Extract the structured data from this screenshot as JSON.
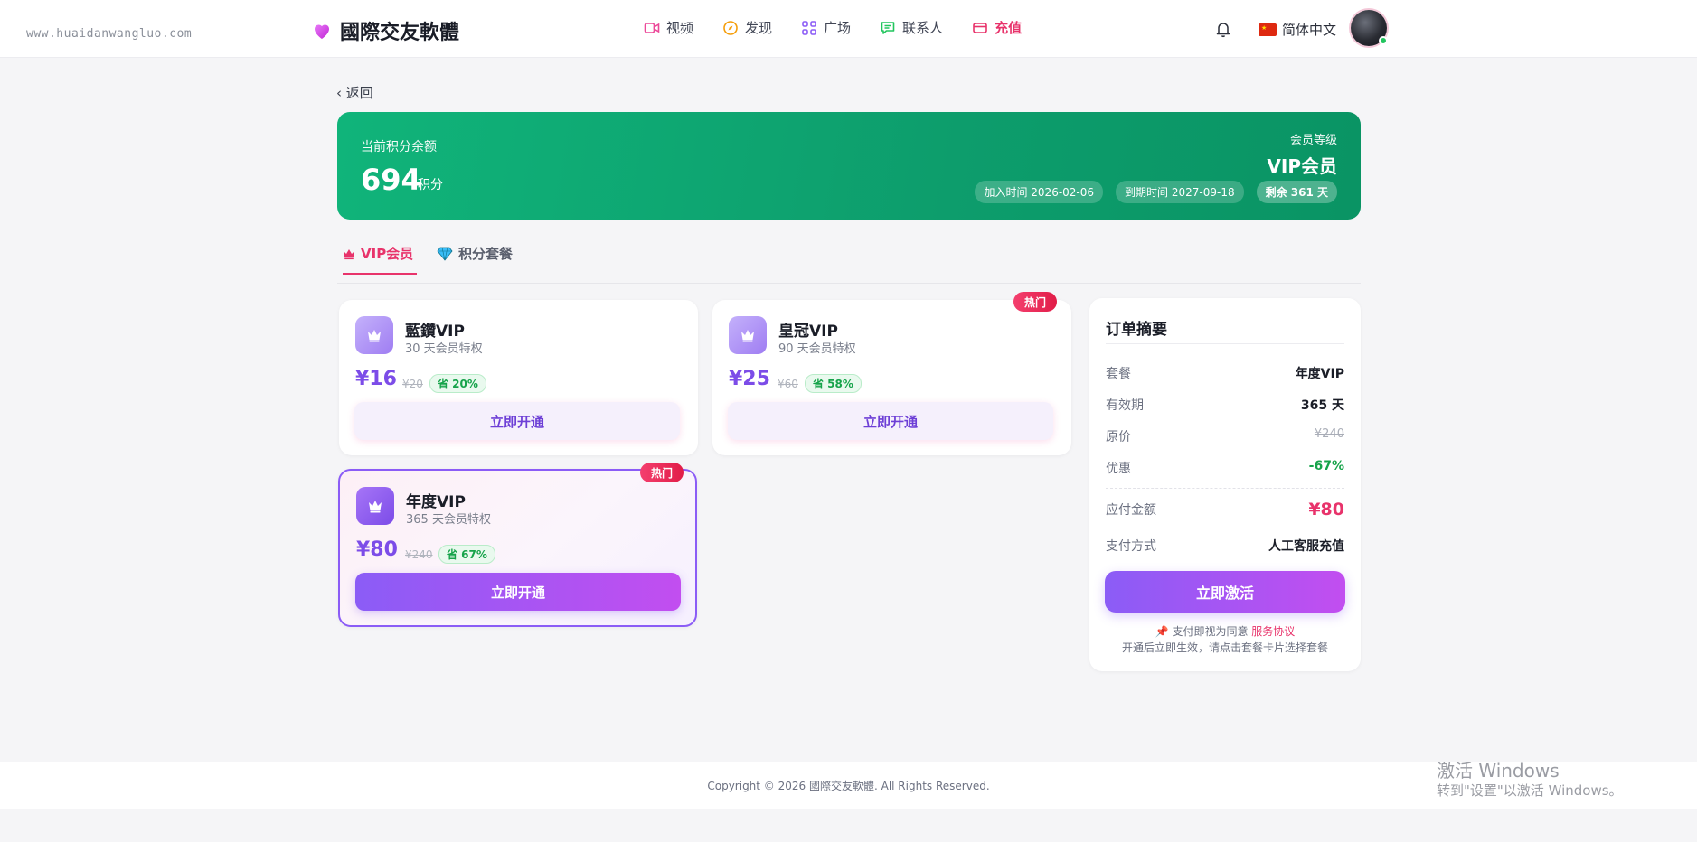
{
  "watermark": "www.huaidanwangluo.com",
  "brand": {
    "name": "國際交友軟體",
    "icon": "heart-icon"
  },
  "nav": [
    {
      "label": "视频",
      "icon": "video-icon"
    },
    {
      "label": "发现",
      "icon": "compass-icon"
    },
    {
      "label": "广场",
      "icon": "grid-icon"
    },
    {
      "label": "联系人",
      "icon": "chat-icon"
    },
    {
      "label": "充值",
      "icon": "wallet-icon",
      "active": true
    }
  ],
  "header": {
    "language": "简体中文",
    "icons": [
      "bell-icon",
      "china-flag-icon",
      "avatar"
    ]
  },
  "back_label": "返回",
  "balance": {
    "label": "当前积分余额",
    "value": "694",
    "unit": "积分",
    "level_label": "会员等级",
    "level_value": "VIP会员",
    "joined": "加入时间 2026-02-06",
    "expires": "到期时间 2027-09-18",
    "remaining": "剩余 361 天"
  },
  "tabs": [
    {
      "label": "VIP会员",
      "icon": "crown-icon",
      "active": true
    },
    {
      "label": "积分套餐",
      "icon": "diamond-icon",
      "active": false
    }
  ],
  "plans": [
    {
      "name": "藍鑽VIP",
      "desc": "30 天会员特权",
      "price": "¥16",
      "orig": "¥20",
      "save": "省 20%",
      "button": "立即开通",
      "hot": "",
      "selected": false
    },
    {
      "name": "皇冠VIP",
      "desc": "90 天会员特权",
      "price": "¥25",
      "orig": "¥60",
      "save": "省 58%",
      "button": "立即开通",
      "hot": "热门",
      "selected": false
    },
    {
      "name": "年度VIP",
      "desc": "365 天会员特权",
      "price": "¥80",
      "orig": "¥240",
      "save": "省 67%",
      "button": "立即开通",
      "hot": "热门",
      "selected": true
    }
  ],
  "summary": {
    "title": "订单摘要",
    "rows": [
      {
        "k": "套餐",
        "v": "年度VIP"
      },
      {
        "k": "有效期",
        "v": "365 天"
      },
      {
        "k": "原价",
        "v": "¥240"
      },
      {
        "k": "优惠",
        "v": "-67%"
      },
      {
        "k": "应付金额",
        "v": "¥80"
      },
      {
        "k": "支付方式",
        "v": "人工客服充值"
      }
    ],
    "activate": "立即激活",
    "agree_text": "支付即视为同意",
    "agree_link": "服务协议",
    "note": "开通后立即生效，请点击套餐卡片选择套餐"
  },
  "footer": "Copyright © 2026 國際交友軟體. All Rights Reserved.",
  "windows": {
    "line1": "激活 Windows",
    "line2": "转到\"设置\"以激活 Windows。"
  },
  "colors": {
    "accent_pink": "#e8336b",
    "accent_purple": "#8b5cf6",
    "green": "#10b47a"
  }
}
